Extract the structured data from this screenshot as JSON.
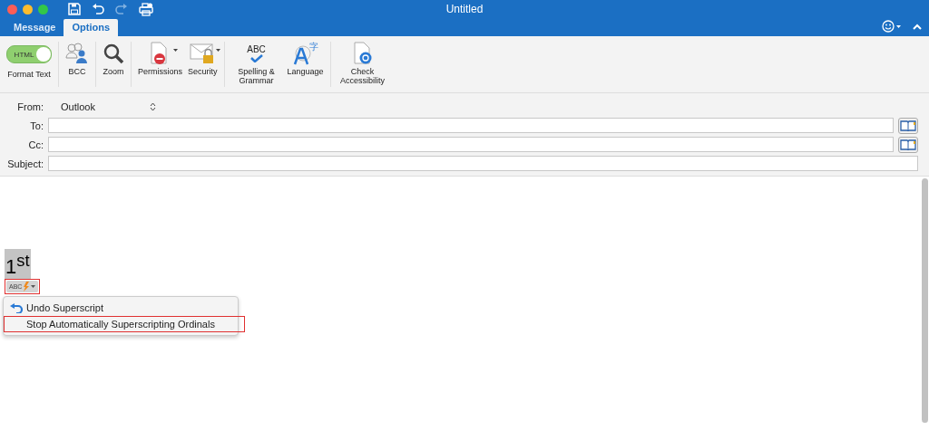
{
  "window": {
    "title": "Untitled"
  },
  "tabs": [
    {
      "label": "Message",
      "selected": false
    },
    {
      "label": "Options",
      "selected": true
    }
  ],
  "ribbon": {
    "format_toggle": {
      "label": "Format Text",
      "toggle_text": "HTML",
      "on": true
    },
    "groups": [
      [
        {
          "kind": "bcc",
          "label": "BCC"
        }
      ],
      [
        {
          "kind": "zoom",
          "label": "Zoom"
        }
      ],
      [
        {
          "kind": "permissions",
          "label": "Permissions",
          "dropdown": true
        },
        {
          "kind": "security",
          "label": "Security",
          "dropdown": true
        }
      ],
      [
        {
          "kind": "spelling",
          "label": "Spelling & Grammar",
          "icon_text": "ABC"
        },
        {
          "kind": "language",
          "label": "Language",
          "icon_text": "字"
        }
      ],
      [
        {
          "kind": "accessibility",
          "label": "Check Accessibility"
        }
      ]
    ]
  },
  "header": {
    "from": {
      "label": "From:",
      "value": "Outlook"
    },
    "fields": [
      {
        "label": "To:",
        "address_book": true
      },
      {
        "label": "Cc:",
        "address_book": true
      },
      {
        "label": "Subject:",
        "address_book": false
      }
    ]
  },
  "body": {
    "text": "1$^{st}$",
    "selected": true,
    "smart_tag": {
      "icon_text": "ABC",
      "outlined": true
    },
    "menu": [
      {
        "kind": "undo",
        "label": "Undo Superscript",
        "outlined": false
      },
      {
        "kind": "plain",
        "label": "Stop Automatically Superscripting Ordinals",
        "outlined": true
      }
    ]
  }
}
